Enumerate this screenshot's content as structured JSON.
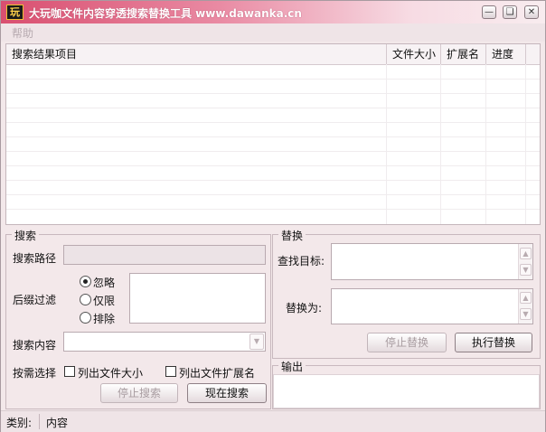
{
  "window": {
    "title": "大玩咖文件内容穿透搜索替换工具 www.dawanka.cn",
    "icon_text": "玩",
    "controls": [
      "minimize-icon",
      "restore-icon",
      "close-icon"
    ]
  },
  "menu": {
    "help": "帮助"
  },
  "results": {
    "columns": [
      "搜索结果项目",
      "文件大小",
      "扩展名",
      "进度"
    ],
    "rows": []
  },
  "search": {
    "group_title": "搜索",
    "path_label": "搜索路径",
    "path_value": "",
    "suffix_label": "后缀过滤",
    "radio_ignore": "忽略",
    "radio_only": "仅限",
    "radio_exclude": "排除",
    "selected_radio": "忽略",
    "suffix_value": "",
    "content_label": "搜索内容",
    "content_value": "",
    "select_label": "按需选择",
    "check_size": "列出文件大小",
    "check_ext": "列出文件扩展名",
    "stop_button": "停止搜索",
    "search_button": "现在搜索"
  },
  "replace": {
    "group_title": "替换",
    "find_label": "查找目标:",
    "find_value": "",
    "replace_label": "替换为:",
    "replace_value": "",
    "stop_button": "停止替换",
    "exec_button": "执行替换"
  },
  "output": {
    "group_title": "输出",
    "text": ""
  },
  "status": {
    "category_label": "类别:",
    "category_value": "内容"
  }
}
